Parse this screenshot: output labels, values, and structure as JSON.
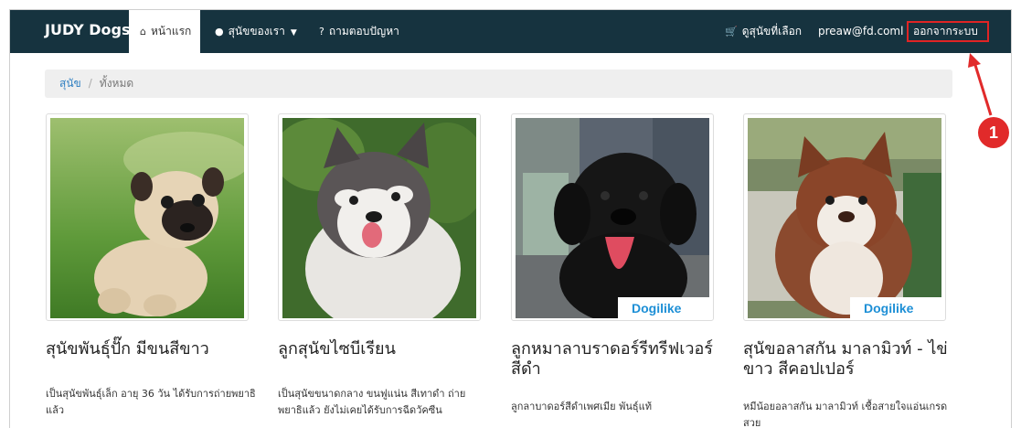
{
  "navbar": {
    "brand": "JUDY Dogs",
    "home_label": "หน้าแรก",
    "dogs_label": "สุนัขของเรา",
    "qa_label": "ถามตอบปัญหา",
    "cart_label": "ดูสุนัขที่เลือก",
    "user_email": "preaw@fd.coml",
    "logout_label": "ออกจากระบบ"
  },
  "breadcrumb": {
    "root": "สุนัข",
    "separator": "/",
    "current": "ทั้งหมด"
  },
  "dogs": [
    {
      "title": "สุนัขพันธุ์ปั๊ก มีขนสีขาว",
      "description": "เป็นสุนัขพันธุ์เล็ก อายุ 36 วัน ได้รับการถ่ายพยาธิแล้ว"
    },
    {
      "title": "ลูกสุนัขไซบีเรียน",
      "description": "เป็นสุนัขขนาดกลาง ขนฟูแน่น สีเทาดำ ถ่ายพยาธิแล้ว ยังไม่เคยได้รับการฉีดวัคซีน"
    },
    {
      "title": "ลูกหมาลาบราดอร์รีทรีฟเวอร์ สีดำ",
      "description": "ลูกลาบาดอร์สีดำเพศเมีย พันธุ์แท้",
      "watermark": "Dogilike"
    },
    {
      "title": "สุนัขอลาสกัน มาลามิวท์ - ไข่ขาว สีคอปเปอร์",
      "description": "หมีน้อยอลาสกัน มาลามิวท์ เชื้อสายใจแอ่นเกรดสวย",
      "watermark": "Dogilike"
    }
  ],
  "annotation": {
    "step_number": "1"
  },
  "colors": {
    "navbar_bg": "#16333f",
    "highlight": "#e02424",
    "link": "#2f7fc1"
  }
}
